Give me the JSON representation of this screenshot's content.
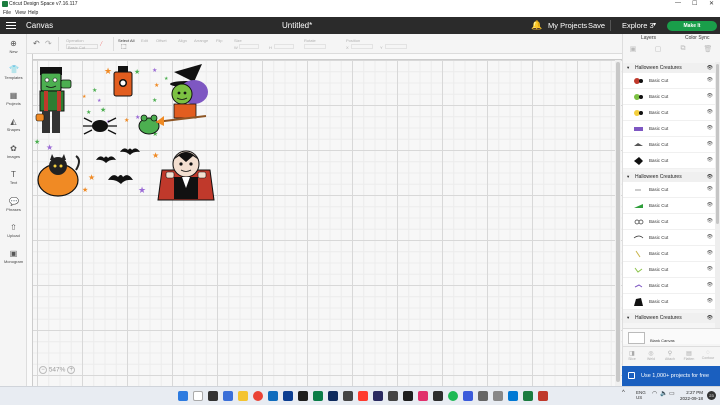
{
  "window": {
    "title": "Cricut Design Space  v7.16.117",
    "controls": [
      "—",
      "☐",
      "✕"
    ]
  },
  "menu": [
    "File",
    "View",
    "Help"
  ],
  "header": {
    "canvas_label": "Canvas",
    "project_name": "Untitled*",
    "my_projects": "My Projects",
    "save": "Save",
    "machine": "Explore 3",
    "make_it": "Make It"
  },
  "toolbar": {
    "undo": "↶",
    "redo": "↷",
    "operation_label": "Operation",
    "operation_value": "Basic Cut",
    "select_all": "Select All",
    "edit": "Edit",
    "offset": "Offset",
    "align": "Align",
    "arrange": "Arrange",
    "flip": "Flip",
    "size": "Size",
    "w": "W",
    "h": "H",
    "rotate": "Rotate",
    "position": "Position",
    "x": "X",
    "y": "Y"
  },
  "sidebar": [
    {
      "label": "New",
      "icon": "plus-icon"
    },
    {
      "label": "Templates",
      "icon": "shirt-icon"
    },
    {
      "label": "Projects",
      "icon": "projects-icon"
    },
    {
      "label": "Shapes",
      "icon": "shapes-icon"
    },
    {
      "label": "Images",
      "icon": "image-icon"
    },
    {
      "label": "Text",
      "icon": "text-icon"
    },
    {
      "label": "Phrases",
      "icon": "phrases-icon"
    },
    {
      "label": "Upload",
      "icon": "upload-icon"
    },
    {
      "label": "Monogram",
      "icon": "monogram-icon"
    }
  ],
  "canvas": {
    "zoom": "547%"
  },
  "right_panel": {
    "tab_layers": "Layers",
    "tab_color_sync": "Color Sync",
    "tools": [
      "Group",
      "UnGroup",
      "Duplicate",
      "Delete"
    ],
    "groups": [
      {
        "name": "Halloween Creatures",
        "layers": [
          "Basic Cut",
          "Basic Cut",
          "Basic Cut",
          "Basic Cut",
          "Basic Cut",
          "Basic Cut"
        ]
      },
      {
        "name": "Halloween Creatures",
        "layers": [
          "Basic Cut",
          "Basic Cut",
          "Basic Cut",
          "Basic Cut",
          "Basic Cut",
          "Basic Cut",
          "Basic Cut",
          "Basic Cut"
        ]
      },
      {
        "name": "Halloween Creatures",
        "layers": []
      }
    ],
    "blank_canvas": "Blank Canvas",
    "bottom_tools": [
      "Slice",
      "Weld",
      "Attach",
      "Flatten",
      "Contour"
    ],
    "promo": "Use 1,000+ projects for free"
  },
  "taskbar": {
    "lang": "ENG",
    "region": "US",
    "time": "2:27 PM",
    "date": "2022-09-18"
  },
  "colors": {
    "accent": "#1a9e4a",
    "header": "#2b2b2b",
    "promo": "#1a5fbf"
  }
}
